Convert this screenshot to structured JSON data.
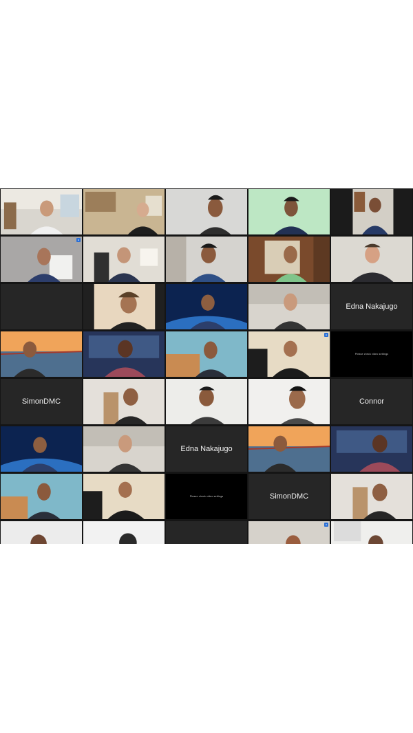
{
  "meeting": {
    "name_tiles": {
      "edna_1": "Edna Nakajugo",
      "simon_1": "SimonDMC",
      "connor": "Connor",
      "edna_2": "Edna Nakajugo",
      "simon_2": "SimonDMC"
    },
    "black_tile_text": "Please check video settings"
  },
  "colors": {
    "grid_background": "#151515",
    "name_tile_background": "#262626",
    "name_text": "#f2f2f2"
  }
}
